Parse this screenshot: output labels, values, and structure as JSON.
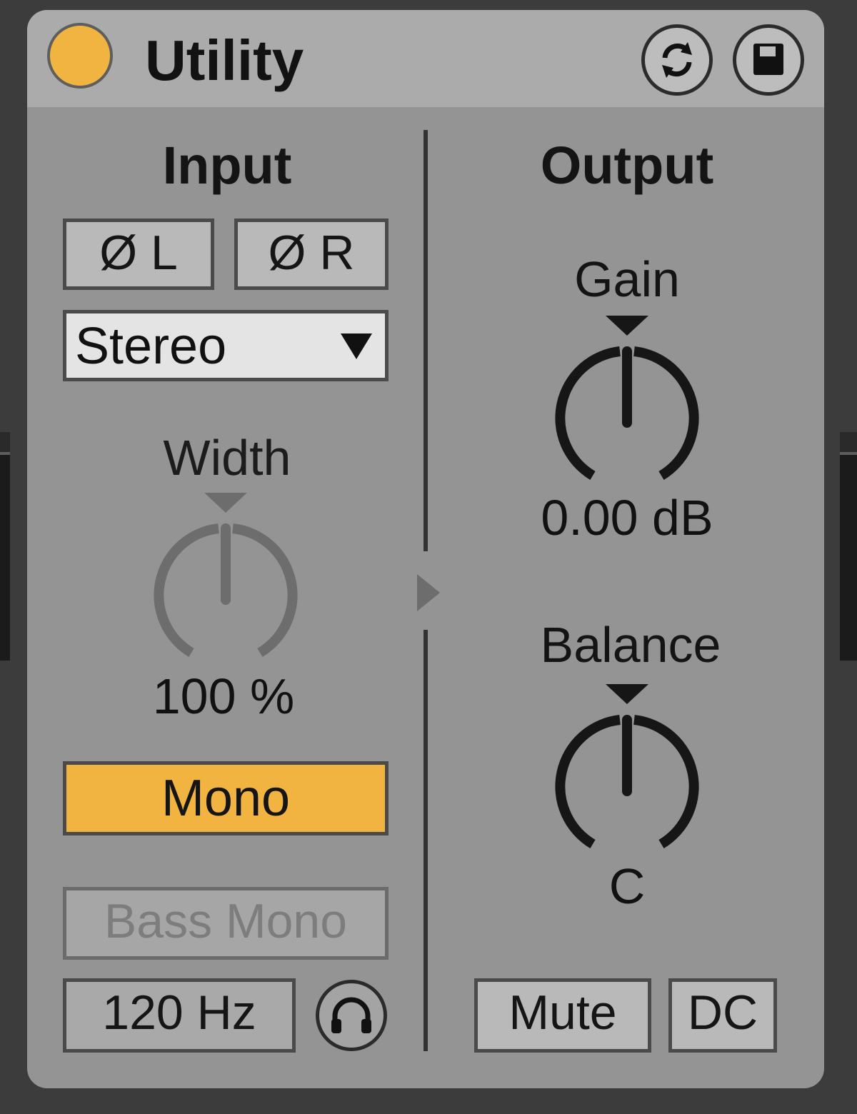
{
  "device": {
    "title": "Utility",
    "accent_color": "#f2b440",
    "hot_swap_icon": "hot-swap-icon",
    "save_icon": "save-preset-icon"
  },
  "input": {
    "label": "Input",
    "phase_left": "Ø L",
    "phase_right": "Ø R",
    "channel_mode": "Stereo",
    "width_label": "Width",
    "width_value": "100 %",
    "mono_label": "Mono",
    "mono_active": true,
    "bass_mono_label": "Bass Mono",
    "bass_mono_freq": "120 Hz",
    "bass_mono_audition_icon": "headphones-icon"
  },
  "output": {
    "label": "Output",
    "gain_label": "Gain",
    "gain_value": "0.00 dB",
    "balance_label": "Balance",
    "balance_value": "C",
    "mute_label": "Mute",
    "dc_label": "DC"
  }
}
